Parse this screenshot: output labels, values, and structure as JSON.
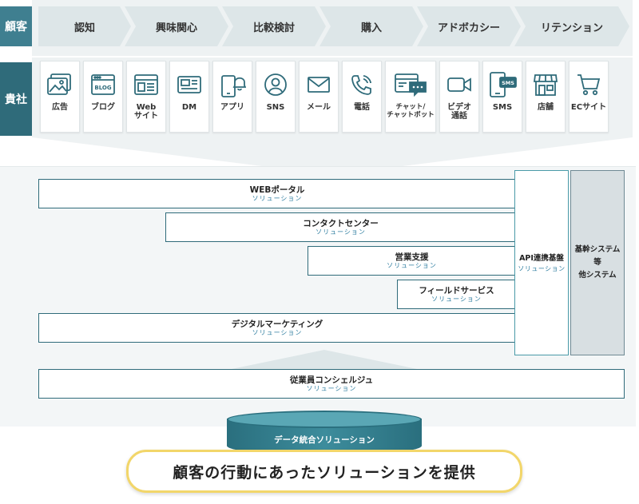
{
  "customer_label": "顧客",
  "company_label": "貴社",
  "journey": [
    "認知",
    "興味関心",
    "比較検討",
    "購入",
    "アドボカシー",
    "リテンション"
  ],
  "channels": [
    {
      "label": "広告",
      "icon": "image-ad-icon"
    },
    {
      "label": "ブログ",
      "icon": "blog-icon",
      "badge": "BLOG"
    },
    {
      "label": "Web\nサイト",
      "icon": "website-icon"
    },
    {
      "label": "DM",
      "icon": "direct-mail-icon"
    },
    {
      "label": "アプリ",
      "icon": "app-notification-icon"
    },
    {
      "label": "SNS",
      "icon": "sns-user-icon"
    },
    {
      "label": "メール",
      "icon": "mail-icon"
    },
    {
      "label": "電話",
      "icon": "phone-icon"
    },
    {
      "label": "チャット/\nチャットボット",
      "icon": "chat-icon"
    },
    {
      "label": "ビデオ\n通話",
      "icon": "video-call-icon"
    },
    {
      "label": "SMS",
      "icon": "sms-icon",
      "badge": "SMS"
    },
    {
      "label": "店舗",
      "icon": "store-icon"
    },
    {
      "label": "ECサイト",
      "icon": "cart-icon"
    }
  ],
  "solutions": [
    {
      "title": "WEBポータル",
      "subtitle": "ソリューション"
    },
    {
      "title": "コンタクトセンター",
      "subtitle": "ソリューション"
    },
    {
      "title": "営業支援",
      "subtitle": "ソリューション"
    },
    {
      "title": "フィールドサービス",
      "subtitle": "ソリューション"
    },
    {
      "title": "デジタルマーケティング",
      "subtitle": "ソリューション"
    },
    {
      "title": "従業員コンシェルジュ",
      "subtitle": "ソリューション"
    }
  ],
  "api": {
    "title": "API連携基盤",
    "subtitle": "ソリューション"
  },
  "core": {
    "line1": "基幹システム",
    "line2": "等",
    "line3": "他システム"
  },
  "database": {
    "label": "データ統合ソリューション"
  },
  "banner": {
    "text": "顧客の行動にあったソリューションを提供"
  },
  "colors": {
    "primary": "#2f6b7a",
    "accent": "#2f7ea0",
    "banner_border": "#f2d66a"
  }
}
